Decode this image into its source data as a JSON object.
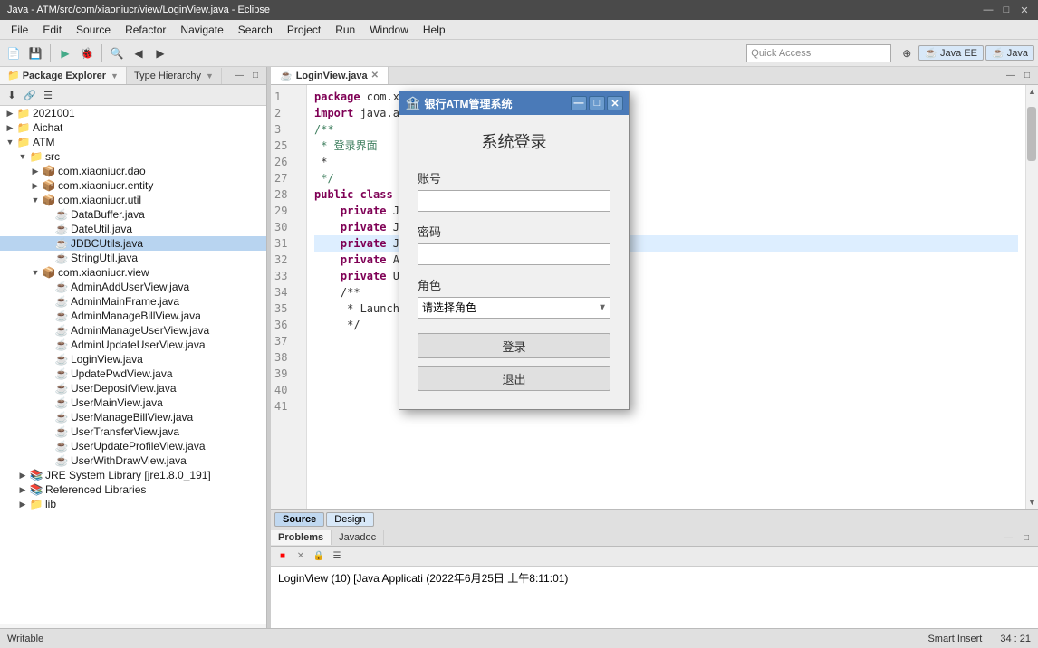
{
  "titlebar": {
    "title": "Java - ATM/src/com/xiaoniucr/view/LoginView.java - Eclipse",
    "minimize": "—",
    "maximize": "□",
    "close": "✕"
  },
  "menubar": {
    "items": [
      "File",
      "Edit",
      "Source",
      "Refactor",
      "Navigate",
      "Search",
      "Project",
      "Run",
      "Window",
      "Help"
    ]
  },
  "toolbar": {
    "quick_access_placeholder": "Quick Access"
  },
  "perspectives": {
    "items": [
      "Java EE",
      "Java"
    ]
  },
  "left_panel": {
    "tabs": [
      {
        "label": "Package Explorer",
        "active": true
      },
      {
        "label": "Type Hierarchy",
        "active": false
      }
    ],
    "tree": [
      {
        "indent": 0,
        "arrow": "▶",
        "icon": "📁",
        "label": "2021001",
        "type": "folder"
      },
      {
        "indent": 0,
        "arrow": "▶",
        "icon": "📁",
        "label": "Aichat",
        "type": "folder"
      },
      {
        "indent": 0,
        "arrow": "▼",
        "icon": "📁",
        "label": "ATM",
        "type": "folder",
        "expanded": true
      },
      {
        "indent": 1,
        "arrow": "▼",
        "icon": "📁",
        "label": "src",
        "type": "folder",
        "expanded": true
      },
      {
        "indent": 2,
        "arrow": "▶",
        "icon": "📦",
        "label": "com.xiaoniucr.dao",
        "type": "package"
      },
      {
        "indent": 2,
        "arrow": "▶",
        "icon": "📦",
        "label": "com.xiaoniucr.entity",
        "type": "package"
      },
      {
        "indent": 2,
        "arrow": "▼",
        "icon": "📦",
        "label": "com.xiaoniucr.util",
        "type": "package",
        "expanded": true
      },
      {
        "indent": 3,
        "arrow": " ",
        "icon": "☕",
        "label": "DataBuffer.java",
        "type": "java"
      },
      {
        "indent": 3,
        "arrow": " ",
        "icon": "☕",
        "label": "DateUtil.java",
        "type": "java"
      },
      {
        "indent": 3,
        "arrow": " ",
        "icon": "☕",
        "label": "JDBCUtils.java",
        "type": "java",
        "selected": true
      },
      {
        "indent": 3,
        "arrow": " ",
        "icon": "☕",
        "label": "StringUtil.java",
        "type": "java"
      },
      {
        "indent": 2,
        "arrow": "▼",
        "icon": "📦",
        "label": "com.xiaoniucr.view",
        "type": "package",
        "expanded": true
      },
      {
        "indent": 3,
        "arrow": " ",
        "icon": "☕",
        "label": "AdminAddUserView.java",
        "type": "java"
      },
      {
        "indent": 3,
        "arrow": " ",
        "icon": "☕",
        "label": "AdminMainFrame.java",
        "type": "java"
      },
      {
        "indent": 3,
        "arrow": " ",
        "icon": "☕",
        "label": "AdminManageBillView.java",
        "type": "java"
      },
      {
        "indent": 3,
        "arrow": " ",
        "icon": "☕",
        "label": "AdminManageUserView.java",
        "type": "java"
      },
      {
        "indent": 3,
        "arrow": " ",
        "icon": "☕",
        "label": "AdminUpdateUserView.java",
        "type": "java"
      },
      {
        "indent": 3,
        "arrow": " ",
        "icon": "☕",
        "label": "LoginView.java",
        "type": "java"
      },
      {
        "indent": 3,
        "arrow": " ",
        "icon": "☕",
        "label": "UpdatePwdView.java",
        "type": "java"
      },
      {
        "indent": 3,
        "arrow": " ",
        "icon": "☕",
        "label": "UserDepositView.java",
        "type": "java"
      },
      {
        "indent": 3,
        "arrow": " ",
        "icon": "☕",
        "label": "UserMainView.java",
        "type": "java"
      },
      {
        "indent": 3,
        "arrow": " ",
        "icon": "☕",
        "label": "UserManageBillView.java",
        "type": "java"
      },
      {
        "indent": 3,
        "arrow": " ",
        "icon": "☕",
        "label": "UserTransferView.java",
        "type": "java"
      },
      {
        "indent": 3,
        "arrow": " ",
        "icon": "☕",
        "label": "UserUpdateProfileView.java",
        "type": "java"
      },
      {
        "indent": 3,
        "arrow": " ",
        "icon": "☕",
        "label": "UserWithDrawView.java",
        "type": "java"
      },
      {
        "indent": 1,
        "arrow": "▶",
        "icon": "📚",
        "label": "JRE System Library [jre1.8.0_191]",
        "type": "library"
      },
      {
        "indent": 1,
        "arrow": "▶",
        "icon": "📚",
        "label": "Referenced Libraries",
        "type": "library"
      },
      {
        "indent": 1,
        "arrow": "▶",
        "icon": "📁",
        "label": "lib",
        "type": "folder"
      }
    ]
  },
  "editor": {
    "tab_label": "LoginView.java",
    "lines": [
      {
        "num": 1,
        "text": "package com.xia",
        "highlight": false
      },
      {
        "num": 2,
        "text": "",
        "highlight": false
      },
      {
        "num": 3,
        "text": "import java.awt.",
        "highlight": false
      },
      {
        "num": 25,
        "text": "",
        "highlight": false
      },
      {
        "num": 26,
        "text": "/**",
        "highlight": false
      },
      {
        "num": 27,
        "text": " * 登录界面",
        "highlight": false
      },
      {
        "num": 28,
        "text": " *",
        "highlight": false
      },
      {
        "num": 29,
        "text": " */",
        "highlight": false
      },
      {
        "num": 30,
        "text": "public class Log",
        "highlight": false
      },
      {
        "num": 31,
        "text": "",
        "highlight": false
      },
      {
        "num": 32,
        "text": "    private JPan",
        "highlight": false
      },
      {
        "num": 33,
        "text": "    private JTex",
        "highlight": false
      },
      {
        "num": 34,
        "text": "    private JPas",
        "highlight": true
      },
      {
        "num": 35,
        "text": "",
        "highlight": false
      },
      {
        "num": 36,
        "text": "    private Admi",
        "highlight": false
      },
      {
        "num": 37,
        "text": "    private User",
        "highlight": false
      },
      {
        "num": 38,
        "text": "",
        "highlight": false
      },
      {
        "num": 39,
        "text": "    /**",
        "highlight": false
      },
      {
        "num": 40,
        "text": "     * Launch th",
        "highlight": false
      },
      {
        "num": 41,
        "text": "     */",
        "highlight": false
      }
    ]
  },
  "bottom_panel": {
    "tabs": [
      "Problems",
      "Javadoc"
    ],
    "console_text": "LoginView (10) [Java Applicati",
    "timestamp": "(2022年6月25日 上午8:11:01)"
  },
  "editor_bottom": {
    "source_label": "Source",
    "design_label": "Design"
  },
  "statusbar": {
    "writable": "Writable",
    "smart_insert": "Smart Insert",
    "position": "34 : 21"
  },
  "dialog": {
    "title": "银行ATM管理系统",
    "header": "系统登录",
    "account_label": "账号",
    "password_label": "密码",
    "role_label": "角色",
    "role_placeholder": "请选择角色",
    "login_btn": "登录",
    "exit_btn": "退出",
    "icon": "🏦"
  }
}
